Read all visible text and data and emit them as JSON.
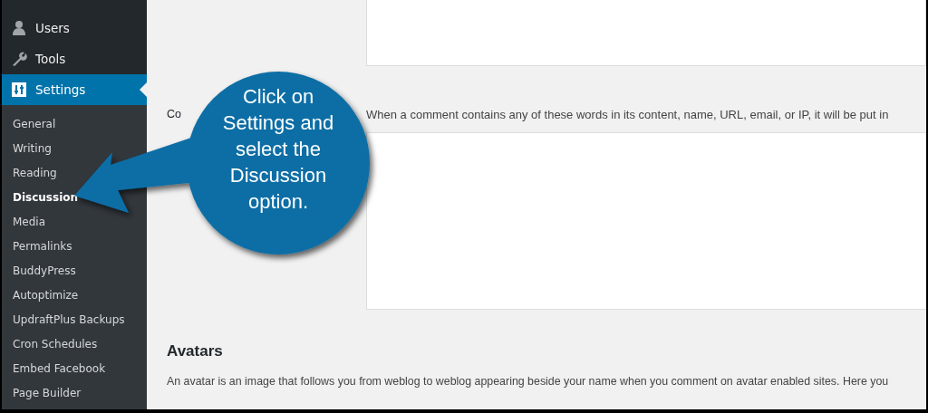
{
  "sidebar": {
    "items": [
      {
        "label": "Users",
        "selected": false
      },
      {
        "label": "Tools",
        "selected": false
      },
      {
        "label": "Settings",
        "selected": true
      }
    ],
    "submenu": [
      {
        "label": "General",
        "selected": false
      },
      {
        "label": "Writing",
        "selected": false
      },
      {
        "label": "Reading",
        "selected": false
      },
      {
        "label": "Discussion",
        "selected": true
      },
      {
        "label": "Media",
        "selected": false
      },
      {
        "label": "Permalinks",
        "selected": false
      },
      {
        "label": "BuddyPress",
        "selected": false
      },
      {
        "label": "Autoptimize",
        "selected": false
      },
      {
        "label": "UpdraftPlus Backups",
        "selected": false
      },
      {
        "label": "Cron Schedules",
        "selected": false
      },
      {
        "label": "Embed Facebook",
        "selected": false
      },
      {
        "label": "Page Builder",
        "selected": false
      }
    ]
  },
  "blacklist": {
    "label": "Co",
    "description": "When a comment contains any of these words in its content, name, URL, email, or IP, it will be put in"
  },
  "avatars": {
    "heading": "Avatars",
    "description": "An avatar is an image that follows you from weblog to weblog appearing beside your name when you comment on avatar enabled sites. Here you"
  },
  "callout": {
    "text": "Click on Settings and select the Discussion option."
  }
}
